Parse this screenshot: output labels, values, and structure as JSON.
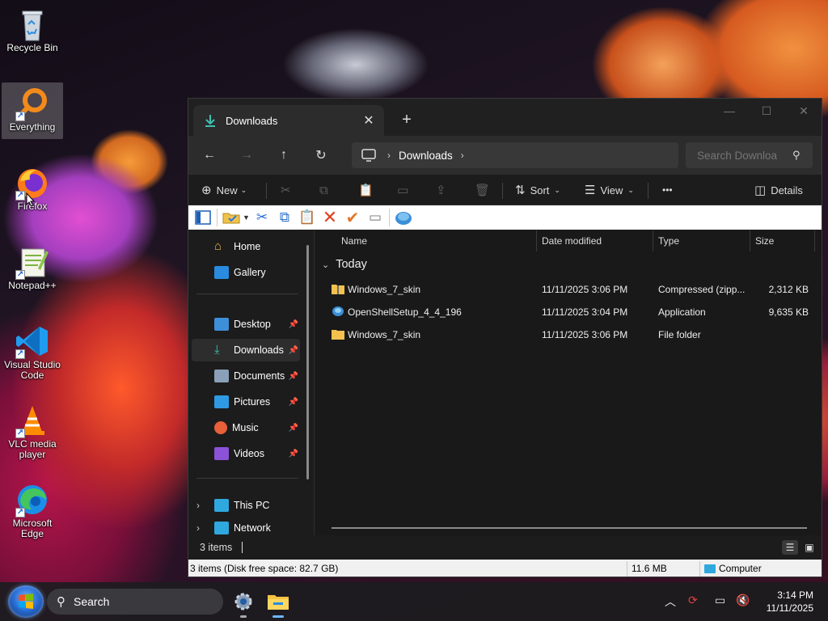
{
  "desktop": {
    "icons": [
      {
        "label": "Recycle Bin"
      },
      {
        "label": "Everything"
      },
      {
        "label": "Firefox"
      },
      {
        "label": "Notepad++"
      },
      {
        "label": "Visual Studio Code"
      },
      {
        "label": "VLC media player"
      },
      {
        "label": "Microsoft Edge"
      }
    ]
  },
  "explorer": {
    "tab_title": "Downloads",
    "address": {
      "crumb": "Downloads"
    },
    "search_placeholder": "Search Downloa",
    "commands": {
      "new": "New",
      "sort": "Sort",
      "view": "View",
      "more": "•••",
      "details": "Details"
    },
    "nav": {
      "home": "Home",
      "gallery": "Gallery",
      "desktop": "Desktop",
      "downloads": "Downloads",
      "documents": "Documents",
      "pictures": "Pictures",
      "music": "Music",
      "videos": "Videos",
      "this_pc": "This PC",
      "network": "Network"
    },
    "columns": {
      "name": "Name",
      "date": "Date modified",
      "type": "Type",
      "size": "Size"
    },
    "group": "Today",
    "files": [
      {
        "name": "Windows_7_skin",
        "date": "11/11/2025 3:06 PM",
        "type": "Compressed (zipp...",
        "size": "2,312 KB",
        "icon": "zip-folder-icon"
      },
      {
        "name": "OpenShellSetup_4_4_196",
        "date": "11/11/2025 3:04 PM",
        "type": "Application",
        "size": "9,635 KB",
        "icon": "open-shell-icon"
      },
      {
        "name": "Windows_7_skin",
        "date": "11/11/2025 3:06 PM",
        "type": "File folder",
        "size": "",
        "icon": "folder-icon"
      }
    ],
    "status": {
      "count": "3 items"
    },
    "classic_status": {
      "left": "3 items (Disk free space: 82.7 GB)",
      "size": "11.6 MB",
      "zone": "Computer"
    }
  },
  "taskbar": {
    "search_label": "Search",
    "clock_time": "3:14 PM",
    "clock_date": "11/11/2025"
  }
}
